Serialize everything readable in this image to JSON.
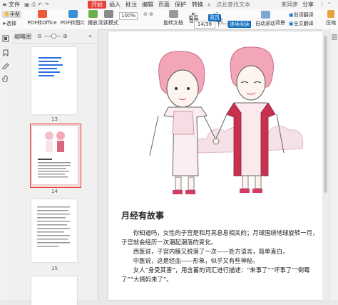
{
  "menu": {
    "file": "文件",
    "start": "开始",
    "insert": "插入",
    "annotate": "批注",
    "edit": "编辑",
    "page": "页面",
    "protect": "保护",
    "convert": "转换",
    "search_placeholder": "点此查找文本",
    "sync": "未同步",
    "share": "分享"
  },
  "toolbar": {
    "hand": "手型",
    "select": "选择",
    "pdf_office": "PDF转Office",
    "pdf_image": "PDF转图片",
    "play": "播放",
    "read_mode": "阅读模式",
    "zoom": "100%",
    "rotate": "旋转文档",
    "first": "首页",
    "prev": "上一页",
    "page_indicator": "14/36",
    "next": "下一页",
    "last": "尾页",
    "single": "单页",
    "double": "双页",
    "continuous": "连续阅读",
    "auto_scroll": "自动滚动",
    "background": "背景",
    "translate_word": "划词翻译",
    "full_translate": "全文翻译",
    "compress": "压缩"
  },
  "thumbnails": {
    "title": "缩略图",
    "pages": [
      {
        "num": "13"
      },
      {
        "num": "14",
        "selected": true
      },
      {
        "num": "15"
      }
    ]
  },
  "document": {
    "heading": "月经有故事",
    "paragraphs": [
      "你知道吗，女性的子宫是和月亮息息相关的；月球围绕地球旋转一月，子宫就会经历一次潮起潮落的变化。",
      "西医说，子宫内膜又脱落了一次——处方语言，简单直白。",
      "中医说，这是经血——形象，似乎又有些神秘。",
      "女人“身受其害”，用含蓄的词汇进行描述：“来事了”“坏事了”“倒霉了”“大姨妈来了”。"
    ]
  },
  "colors": {
    "accent_red": "#e8413b",
    "accent_blue": "#0e6dbf",
    "hair_pink": "#f3a6b7",
    "vest_red": "#c8324f"
  }
}
